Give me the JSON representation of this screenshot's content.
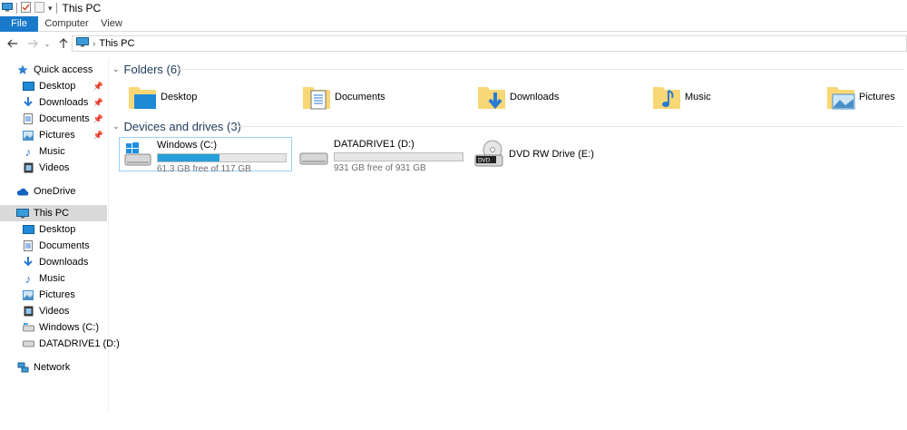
{
  "window": {
    "title": "This PC"
  },
  "ribbon": {
    "tabs": [
      "File",
      "Computer",
      "View"
    ]
  },
  "address": {
    "location": "This PC"
  },
  "nav": {
    "quick_access": "Quick access",
    "quick_items": [
      "Desktop",
      "Downloads",
      "Documents",
      "Pictures",
      "Music",
      "Videos"
    ],
    "onedrive": "OneDrive",
    "this_pc": "This PC",
    "pc_items": [
      "Desktop",
      "Documents",
      "Downloads",
      "Music",
      "Pictures",
      "Videos",
      "Windows (C:)",
      "DATADRIVE1 (D:)"
    ],
    "network": "Network"
  },
  "content": {
    "folders_header": "Folders (6)",
    "folders": [
      "Desktop",
      "Documents",
      "Downloads",
      "Music",
      "Pictures"
    ],
    "drives_header": "Devices and drives (3)",
    "drives": [
      {
        "name": "Windows (C:)",
        "free": "61.3 GB free of 117 GB",
        "used_fraction": 0.48
      },
      {
        "name": "DATADRIVE1 (D:)",
        "free": "931 GB free of 931 GB",
        "used_fraction": 0.0
      },
      {
        "name": "DVD RW Drive (E:)"
      }
    ]
  },
  "colors": {
    "accent": "#1979ca",
    "usage_bar": "#26a0da",
    "selection": "#d9d9d9"
  }
}
